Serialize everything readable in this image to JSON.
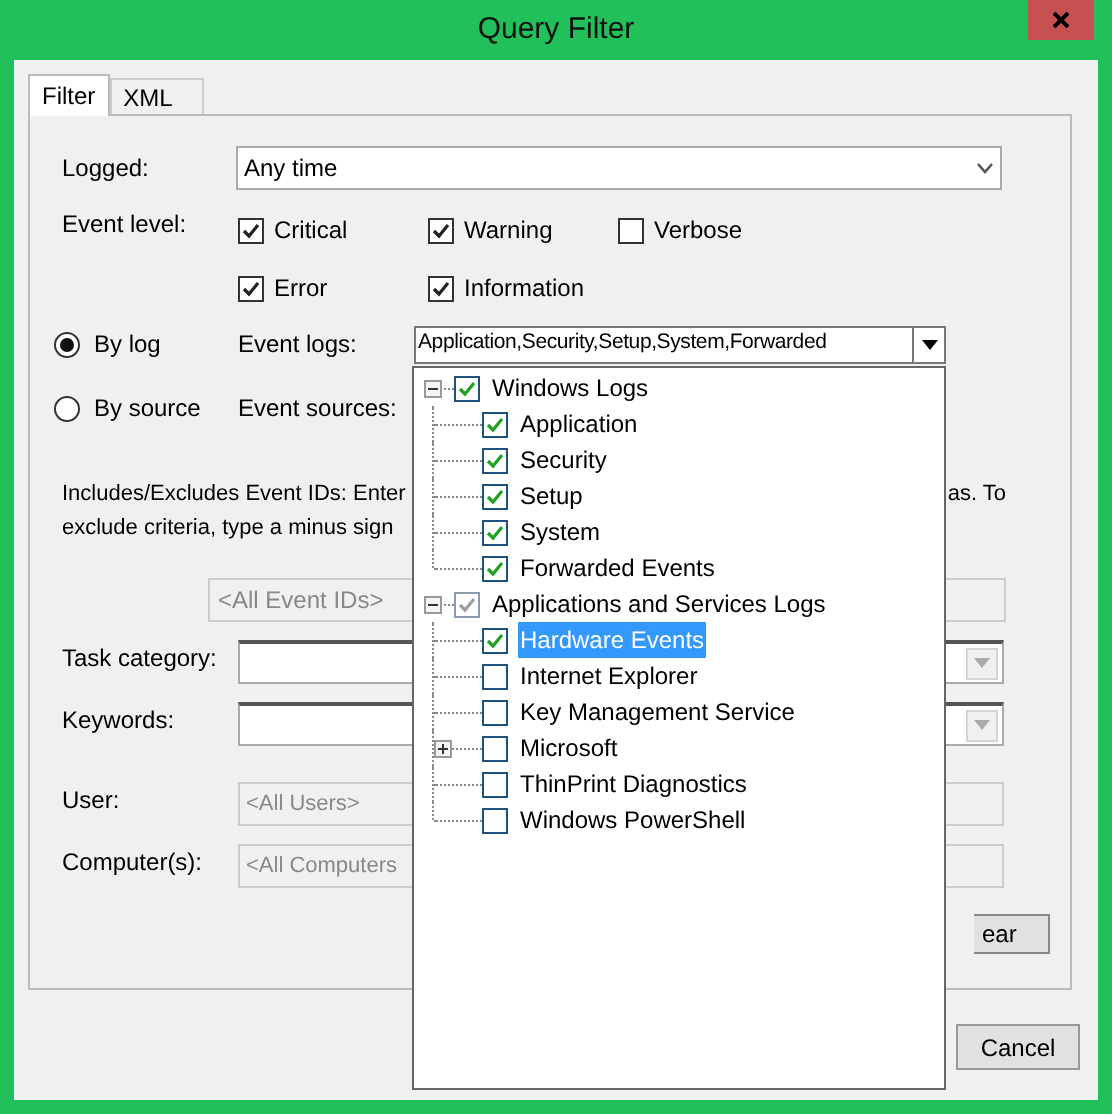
{
  "window": {
    "title": "Query Filter"
  },
  "tabs": [
    {
      "label": "Filter",
      "selected": true
    },
    {
      "label": "XML",
      "selected": false
    }
  ],
  "logged": {
    "label": "Logged:",
    "value": "Any time"
  },
  "event_level": {
    "label": "Event level:",
    "options": [
      {
        "label": "Critical",
        "checked": true
      },
      {
        "label": "Warning",
        "checked": true
      },
      {
        "label": "Verbose",
        "checked": false
      },
      {
        "label": "Error",
        "checked": true
      },
      {
        "label": "Information",
        "checked": true
      }
    ]
  },
  "source_modes": [
    {
      "label": "By log",
      "selected": true,
      "field_label": "Event logs:"
    },
    {
      "label": "By source",
      "selected": false,
      "field_label": "Event sources:"
    }
  ],
  "event_logs_value": "Application,Security,Setup,System,Forwarded",
  "event_ids_help": {
    "line_1_left": "Includes/Excludes Event IDs: Enter",
    "line_1_right": "as. To",
    "line_2": "exclude criteria, type a minus sign"
  },
  "event_ids": {
    "placeholder": "<All Event IDs>"
  },
  "task_category": {
    "label": "Task category:"
  },
  "keywords": {
    "label": "Keywords:"
  },
  "user": {
    "label": "User:",
    "placeholder": "<All Users>"
  },
  "computers": {
    "label": "Computer(s):",
    "placeholder": "<All Computers"
  },
  "clear_button": "ear",
  "log_tree": [
    {
      "label": "Windows Logs",
      "checked": true,
      "dimmed": false,
      "selected": false,
      "expanded": true,
      "children": [
        {
          "label": "Application",
          "checked": true,
          "dimmed": false,
          "selected": false
        },
        {
          "label": "Security",
          "checked": true,
          "dimmed": false,
          "selected": false
        },
        {
          "label": "Setup",
          "checked": true,
          "dimmed": false,
          "selected": false
        },
        {
          "label": "System",
          "checked": true,
          "dimmed": false,
          "selected": false
        },
        {
          "label": "Forwarded Events",
          "checked": true,
          "dimmed": false,
          "selected": false
        }
      ]
    },
    {
      "label": "Applications and Services Logs",
      "checked": true,
      "dimmed": true,
      "selected": false,
      "expanded": true,
      "children": [
        {
          "label": "Hardware Events",
          "checked": true,
          "dimmed": false,
          "selected": true
        },
        {
          "label": "Internet Explorer",
          "checked": false,
          "dimmed": false,
          "selected": false
        },
        {
          "label": "Key Management Service",
          "checked": false,
          "dimmed": false,
          "selected": false
        },
        {
          "label": "Microsoft",
          "checked": false,
          "dimmed": false,
          "selected": false,
          "expanded": false
        },
        {
          "label": "ThinPrint Diagnostics",
          "checked": false,
          "dimmed": false,
          "selected": false
        },
        {
          "label": "Windows PowerShell",
          "checked": false,
          "dimmed": false,
          "selected": false
        }
      ]
    }
  ],
  "buttons": [
    "Cancel"
  ]
}
